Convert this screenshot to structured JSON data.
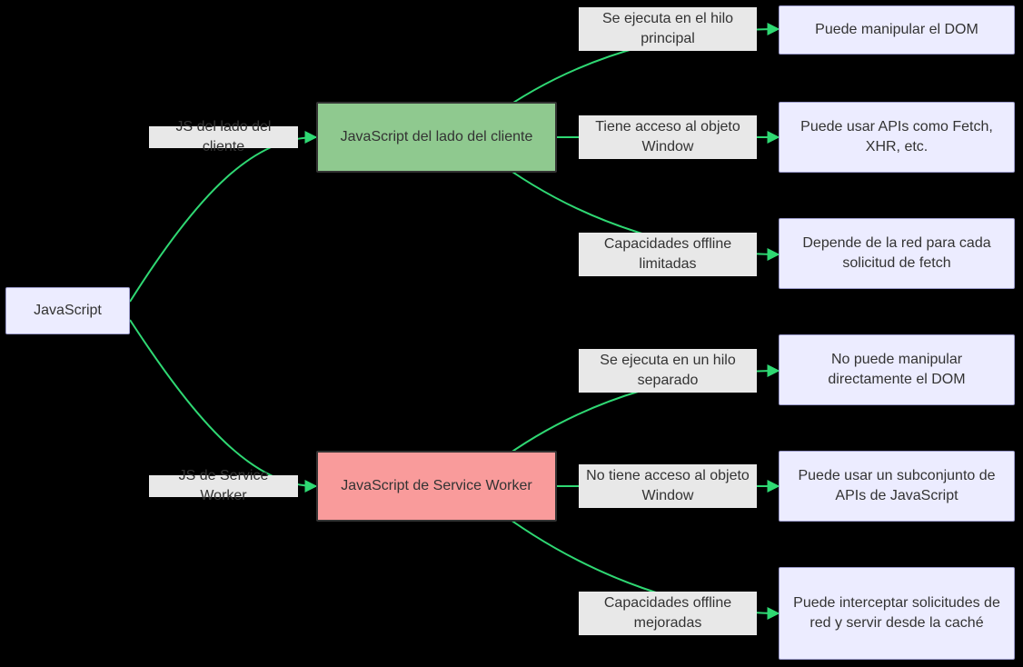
{
  "nodes": {
    "root": {
      "label": "JavaScript"
    },
    "client": {
      "label": "JavaScript del lado del cliente"
    },
    "sw": {
      "label": "JavaScript de Service Worker"
    },
    "c1": {
      "label": "Puede manipular el DOM"
    },
    "c2": {
      "label": "Puede usar APIs como Fetch, XHR, etc."
    },
    "c3": {
      "label": "Depende de la red para cada solicitud de fetch"
    },
    "s1": {
      "label": "No puede manipular directamente el DOM"
    },
    "s2": {
      "label": "Puede usar un subconjunto de APIs de JavaScript"
    },
    "s3": {
      "label": "Puede interceptar solicitudes de red y servir desde la caché"
    }
  },
  "edgeLabels": {
    "e_root_client": "JS del lado del cliente",
    "e_root_sw": "JS de Service Worker",
    "e_client_c1": "Se ejecuta en el hilo principal",
    "e_client_c2": "Tiene acceso al objeto Window",
    "e_client_c3": "Capacidades offline limitadas",
    "e_sw_s1": "Se ejecuta en un hilo separado",
    "e_sw_s2": "No tiene acceso al objeto Window",
    "e_sw_s3": "Capacidades offline mejoradas"
  },
  "colors": {
    "edge": "#2fd873",
    "labelBg": "#e8e8e8",
    "nodeDefaultBg": "#ECECFF",
    "nodeGreenBg": "#8fc98f",
    "nodeRedBg": "#f99b9b"
  }
}
